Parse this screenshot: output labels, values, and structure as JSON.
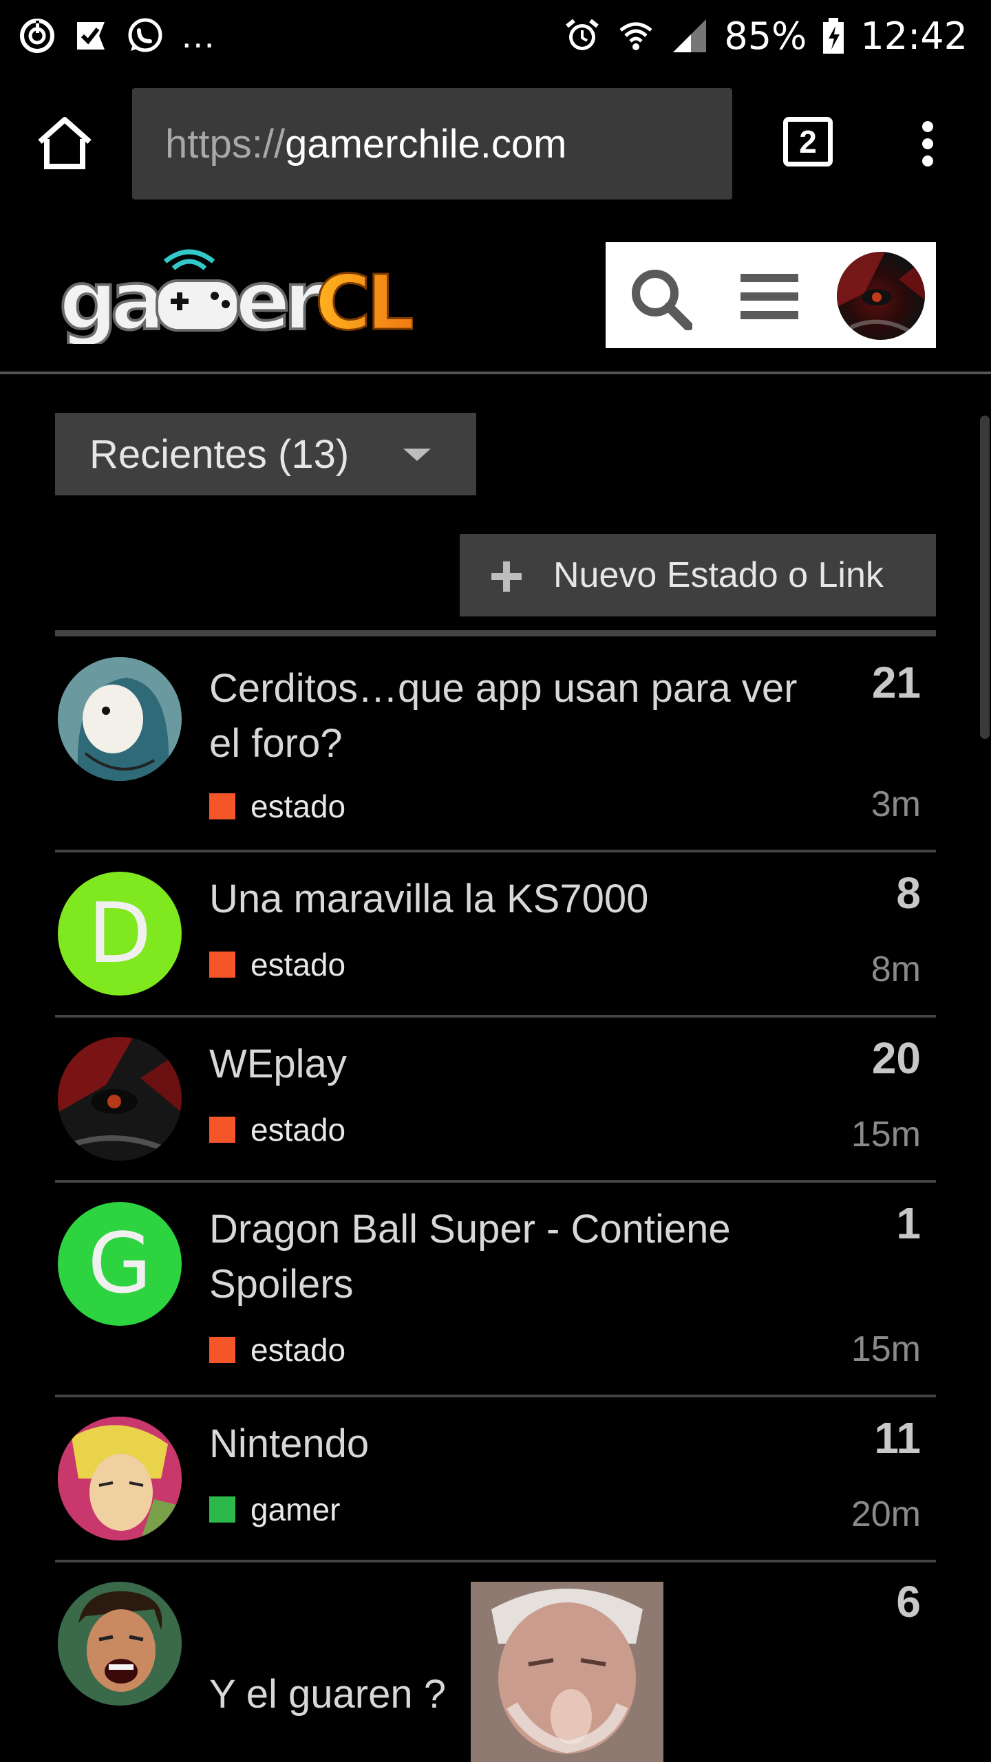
{
  "status_bar": {
    "icons_left": [
      "sync-icon",
      "check-flag-icon",
      "whatsapp-icon"
    ],
    "overflow": "...",
    "icons_right": [
      "alarm-icon",
      "wifi-icon",
      "signal-icon"
    ],
    "battery": "85%",
    "time": "12:42"
  },
  "browser": {
    "url_scheme": "https://",
    "url_host": "gamerchile.com",
    "tab_count": "2"
  },
  "site": {
    "logo_alt": "gamerCL"
  },
  "filter": {
    "label": "Recientes (13)"
  },
  "new_button": {
    "label": "Nuevo Estado o Link"
  },
  "colors": {
    "estado": "#f4562a",
    "gamer": "#2db84b"
  },
  "topics": [
    {
      "title": "Cerditos…que app usan para ver el foro?",
      "category": "estado",
      "count": "21",
      "time": "3m"
    },
    {
      "title": "Una maravilla la KS7000",
      "category": "estado",
      "count": "8",
      "time": "8m",
      "avatar_letter": "D",
      "avatar_color": "#7fe81f"
    },
    {
      "title": "WEplay",
      "category": "estado",
      "count": "20",
      "time": "15m"
    },
    {
      "title": "Dragon Ball Super - Contiene Spoilers",
      "category": "estado",
      "count": "1",
      "time": "15m",
      "avatar_letter": "G",
      "avatar_color": "#2ed43f"
    },
    {
      "title": "Nintendo",
      "category": "gamer",
      "count": "11",
      "time": "20m"
    },
    {
      "title": "Y el guaren ?",
      "count": "6"
    }
  ]
}
